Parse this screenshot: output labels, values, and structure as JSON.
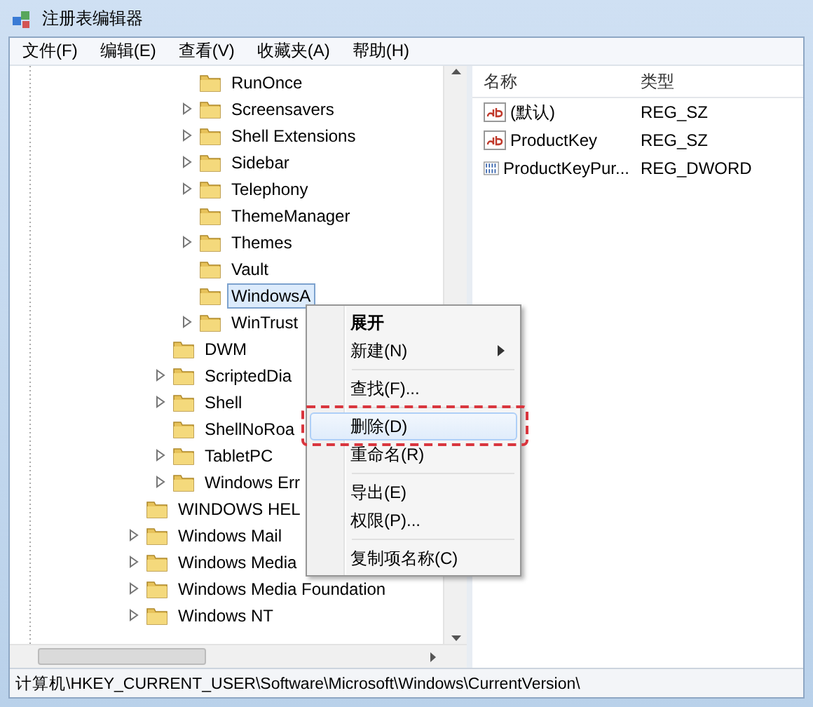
{
  "window": {
    "title": "注册表编辑器"
  },
  "menu_bar": [
    "文件(F)",
    "编辑(E)",
    "查看(V)",
    "收藏夹(A)",
    "帮助(H)"
  ],
  "tree": {
    "items": [
      {
        "children": [
          {
            "children": [
              {
                "name": "RunOnce",
                "expandable": false,
                "selected": false
              },
              {
                "name": "Screensavers",
                "expandable": true,
                "selected": false
              },
              {
                "name": "Shell Extensions",
                "expandable": true,
                "selected": false
              },
              {
                "name": "Sidebar",
                "expandable": true,
                "selected": false
              },
              {
                "name": "Telephony",
                "expandable": true,
                "selected": false
              },
              {
                "name": "ThemeManager",
                "expandable": false,
                "selected": false
              },
              {
                "name": "Themes",
                "expandable": true,
                "selected": false
              },
              {
                "name": "Vault",
                "expandable": false,
                "selected": false
              },
              {
                "name": "WindowsA",
                "expandable": false,
                "selected": true
              },
              {
                "name": "WinTrust",
                "expandable": true,
                "selected": false
              }
            ]
          },
          {
            "name": "DWM",
            "expandable": false,
            "selected": false
          },
          {
            "name": "ScriptedDia",
            "expandable": true,
            "selected": false
          },
          {
            "name": "Shell",
            "expandable": true,
            "selected": false
          },
          {
            "name": "ShellNoRoa",
            "expandable": false,
            "selected": false
          },
          {
            "name": "TabletPC",
            "expandable": true,
            "selected": false
          },
          {
            "name": "Windows Err",
            "expandable": true,
            "selected": false
          }
        ]
      },
      {
        "name": "WINDOWS HEL",
        "expandable": false,
        "selected": false
      },
      {
        "name": "Windows Mail",
        "expandable": true,
        "selected": false
      },
      {
        "name": "Windows Media",
        "expandable": true,
        "selected": false
      },
      {
        "name": "Windows Media Foundation",
        "expandable": true,
        "selected": false
      },
      {
        "name": "Windows NT",
        "expandable": true,
        "selected": false
      }
    ]
  },
  "values_pane": {
    "columns": [
      "名称",
      "类型"
    ],
    "rows": [
      {
        "kind": "string",
        "name": "(默认)",
        "type": "REG_SZ"
      },
      {
        "kind": "string",
        "name": "ProductKey",
        "type": "REG_SZ"
      },
      {
        "kind": "number",
        "name": "ProductKeyPur...",
        "type": "REG_DWORD"
      }
    ]
  },
  "context_menu": {
    "groups": [
      [
        {
          "label": "展开",
          "default": true,
          "submenu": false,
          "selected": false
        },
        {
          "label": "新建(N)",
          "default": false,
          "submenu": true,
          "selected": false
        }
      ],
      [
        {
          "label": "查找(F)...",
          "default": false,
          "submenu": false,
          "selected": false
        }
      ],
      [
        {
          "label": "删除(D)",
          "default": false,
          "submenu": false,
          "selected": true
        },
        {
          "label": "重命名(R)",
          "default": false,
          "submenu": false,
          "selected": false
        }
      ],
      [
        {
          "label": "导出(E)",
          "default": false,
          "submenu": false,
          "selected": false
        },
        {
          "label": "权限(P)...",
          "default": false,
          "submenu": false,
          "selected": false
        }
      ],
      [
        {
          "label": "复制项名称(C)",
          "default": false,
          "submenu": false,
          "selected": false
        }
      ]
    ]
  },
  "status_bar": "计算机\\HKEY_CURRENT_USER\\Software\\Microsoft\\Windows\\CurrentVersion\\"
}
